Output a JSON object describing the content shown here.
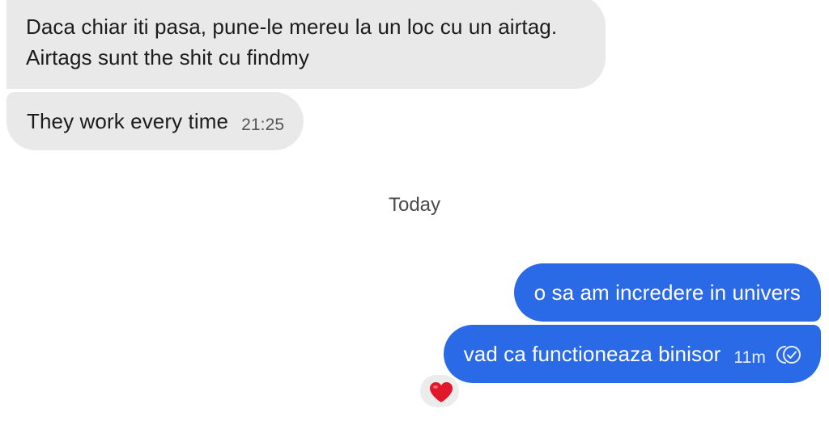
{
  "messages": [
    {
      "text": "Daca chiar iti pasa, pune-le mereu la un loc cu un airtag. Airtags sunt the shit cu findmy",
      "time": ""
    },
    {
      "text": "They work every time",
      "time": "21:25"
    },
    {
      "text": "o sa am incredere in univers",
      "time": ""
    },
    {
      "text": "vad ca functioneaza binisor",
      "time": "11m",
      "status_icon": "double-check-icon"
    }
  ],
  "divider": {
    "label": "Today"
  },
  "reaction": {
    "emoji": "heart-icon"
  },
  "colors": {
    "incoming_bubble": "#e9e9e9",
    "outgoing_bubble": "#2b6ae6",
    "heart": "#e0182c"
  }
}
